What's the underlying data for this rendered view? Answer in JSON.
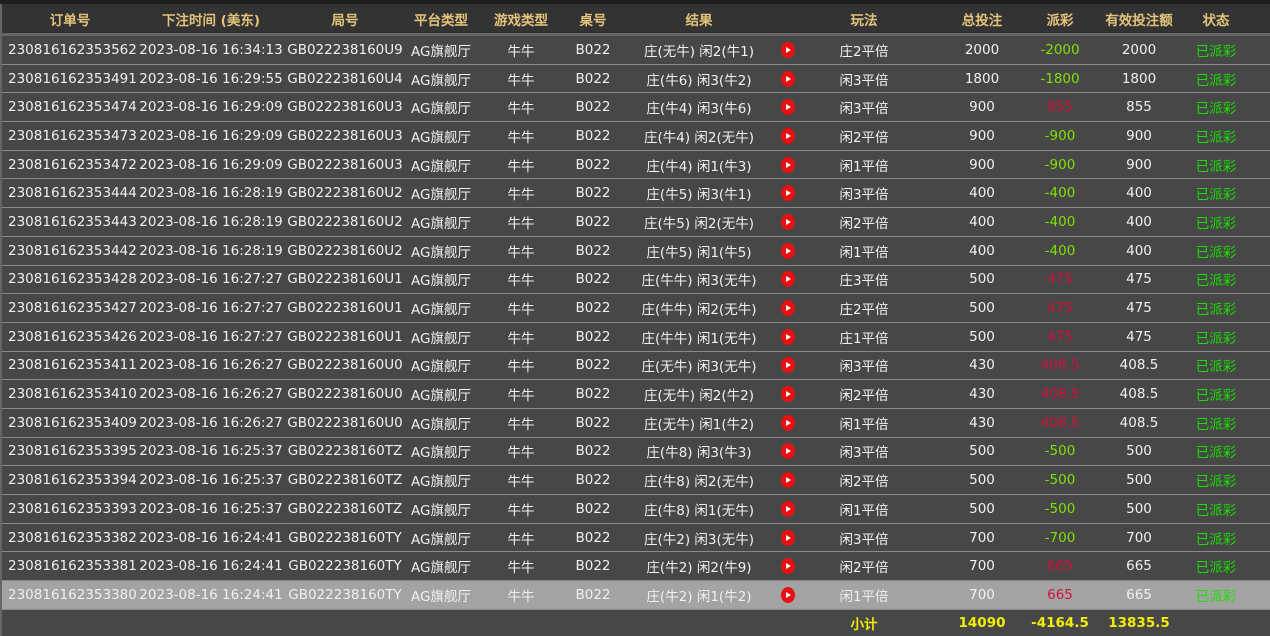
{
  "headers": [
    "订单号",
    "下注时间 (美东)",
    "局号",
    "平台类型",
    "游戏类型",
    "桌号",
    "结果",
    "",
    "玩法",
    "总投注",
    "派彩",
    "有效投注额",
    "状态"
  ],
  "colors": {
    "header_text": "#e3c37a",
    "payout_negative": "#7fe000",
    "payout_positive": "#d0103a",
    "status": "#17e000",
    "total": "#f2f000"
  },
  "rows": [
    [
      "230816162353562",
      "2023-08-16 16:34:13",
      "GB022238160U9",
      "AG旗舰厅",
      "牛牛",
      "B022",
      "庄(无牛) 闲2(牛1)",
      "庄2平倍",
      "2000",
      "-2000",
      "2000",
      "已派彩"
    ],
    [
      "230816162353491",
      "2023-08-16 16:29:55",
      "GB022238160U4",
      "AG旗舰厅",
      "牛牛",
      "B022",
      "庄(牛6) 闲3(牛2)",
      "闲3平倍",
      "1800",
      "-1800",
      "1800",
      "已派彩"
    ],
    [
      "230816162353474",
      "2023-08-16 16:29:09",
      "GB022238160U3",
      "AG旗舰厅",
      "牛牛",
      "B022",
      "庄(牛4) 闲3(牛6)",
      "闲3平倍",
      "900",
      "855",
      "855",
      "已派彩"
    ],
    [
      "230816162353473",
      "2023-08-16 16:29:09",
      "GB022238160U3",
      "AG旗舰厅",
      "牛牛",
      "B022",
      "庄(牛4) 闲2(无牛)",
      "闲2平倍",
      "900",
      "-900",
      "900",
      "已派彩"
    ],
    [
      "230816162353472",
      "2023-08-16 16:29:09",
      "GB022238160U3",
      "AG旗舰厅",
      "牛牛",
      "B022",
      "庄(牛4) 闲1(牛3)",
      "闲1平倍",
      "900",
      "-900",
      "900",
      "已派彩"
    ],
    [
      "230816162353444",
      "2023-08-16 16:28:19",
      "GB022238160U2",
      "AG旗舰厅",
      "牛牛",
      "B022",
      "庄(牛5) 闲3(牛1)",
      "闲3平倍",
      "400",
      "-400",
      "400",
      "已派彩"
    ],
    [
      "230816162353443",
      "2023-08-16 16:28:19",
      "GB022238160U2",
      "AG旗舰厅",
      "牛牛",
      "B022",
      "庄(牛5) 闲2(无牛)",
      "闲2平倍",
      "400",
      "-400",
      "400",
      "已派彩"
    ],
    [
      "230816162353442",
      "2023-08-16 16:28:19",
      "GB022238160U2",
      "AG旗舰厅",
      "牛牛",
      "B022",
      "庄(牛5) 闲1(牛5)",
      "闲1平倍",
      "400",
      "-400",
      "400",
      "已派彩"
    ],
    [
      "230816162353428",
      "2023-08-16 16:27:27",
      "GB022238160U1",
      "AG旗舰厅",
      "牛牛",
      "B022",
      "庄(牛牛) 闲3(无牛)",
      "庄3平倍",
      "500",
      "475",
      "475",
      "已派彩"
    ],
    [
      "230816162353427",
      "2023-08-16 16:27:27",
      "GB022238160U1",
      "AG旗舰厅",
      "牛牛",
      "B022",
      "庄(牛牛) 闲2(无牛)",
      "庄2平倍",
      "500",
      "475",
      "475",
      "已派彩"
    ],
    [
      "230816162353426",
      "2023-08-16 16:27:27",
      "GB022238160U1",
      "AG旗舰厅",
      "牛牛",
      "B022",
      "庄(牛牛) 闲1(无牛)",
      "庄1平倍",
      "500",
      "475",
      "475",
      "已派彩"
    ],
    [
      "230816162353411",
      "2023-08-16 16:26:27",
      "GB022238160U0",
      "AG旗舰厅",
      "牛牛",
      "B022",
      "庄(无牛) 闲3(无牛)",
      "闲3平倍",
      "430",
      "408.5",
      "408.5",
      "已派彩"
    ],
    [
      "230816162353410",
      "2023-08-16 16:26:27",
      "GB022238160U0",
      "AG旗舰厅",
      "牛牛",
      "B022",
      "庄(无牛) 闲2(牛2)",
      "闲2平倍",
      "430",
      "408.5",
      "408.5",
      "已派彩"
    ],
    [
      "230816162353409",
      "2023-08-16 16:26:27",
      "GB022238160U0",
      "AG旗舰厅",
      "牛牛",
      "B022",
      "庄(无牛) 闲1(牛2)",
      "闲1平倍",
      "430",
      "408.5",
      "408.5",
      "已派彩"
    ],
    [
      "230816162353395",
      "2023-08-16 16:25:37",
      "GB022238160TZ",
      "AG旗舰厅",
      "牛牛",
      "B022",
      "庄(牛8) 闲3(牛3)",
      "闲3平倍",
      "500",
      "-500",
      "500",
      "已派彩"
    ],
    [
      "230816162353394",
      "2023-08-16 16:25:37",
      "GB022238160TZ",
      "AG旗舰厅",
      "牛牛",
      "B022",
      "庄(牛8) 闲2(无牛)",
      "闲2平倍",
      "500",
      "-500",
      "500",
      "已派彩"
    ],
    [
      "230816162353393",
      "2023-08-16 16:25:37",
      "GB022238160TZ",
      "AG旗舰厅",
      "牛牛",
      "B022",
      "庄(牛8) 闲1(无牛)",
      "闲1平倍",
      "500",
      "-500",
      "500",
      "已派彩"
    ],
    [
      "230816162353382",
      "2023-08-16 16:24:41",
      "GB022238160TY",
      "AG旗舰厅",
      "牛牛",
      "B022",
      "庄(牛2) 闲3(无牛)",
      "闲3平倍",
      "700",
      "-700",
      "700",
      "已派彩"
    ],
    [
      "230816162353381",
      "2023-08-16 16:24:41",
      "GB022238160TY",
      "AG旗舰厅",
      "牛牛",
      "B022",
      "庄(牛2) 闲2(牛9)",
      "闲2平倍",
      "700",
      "665",
      "665",
      "已派彩"
    ],
    [
      "230816162353380",
      "2023-08-16 16:24:41",
      "GB022238160TY",
      "AG旗舰厅",
      "牛牛",
      "B022",
      "庄(牛2) 闲1(牛2)",
      "闲1平倍",
      "700",
      "665",
      "665",
      "已派彩"
    ]
  ],
  "selected_row": 19,
  "footer": {
    "label": "小计",
    "total_bet": "14090",
    "payout": "-4164.5",
    "valid_bet": "13835.5"
  }
}
